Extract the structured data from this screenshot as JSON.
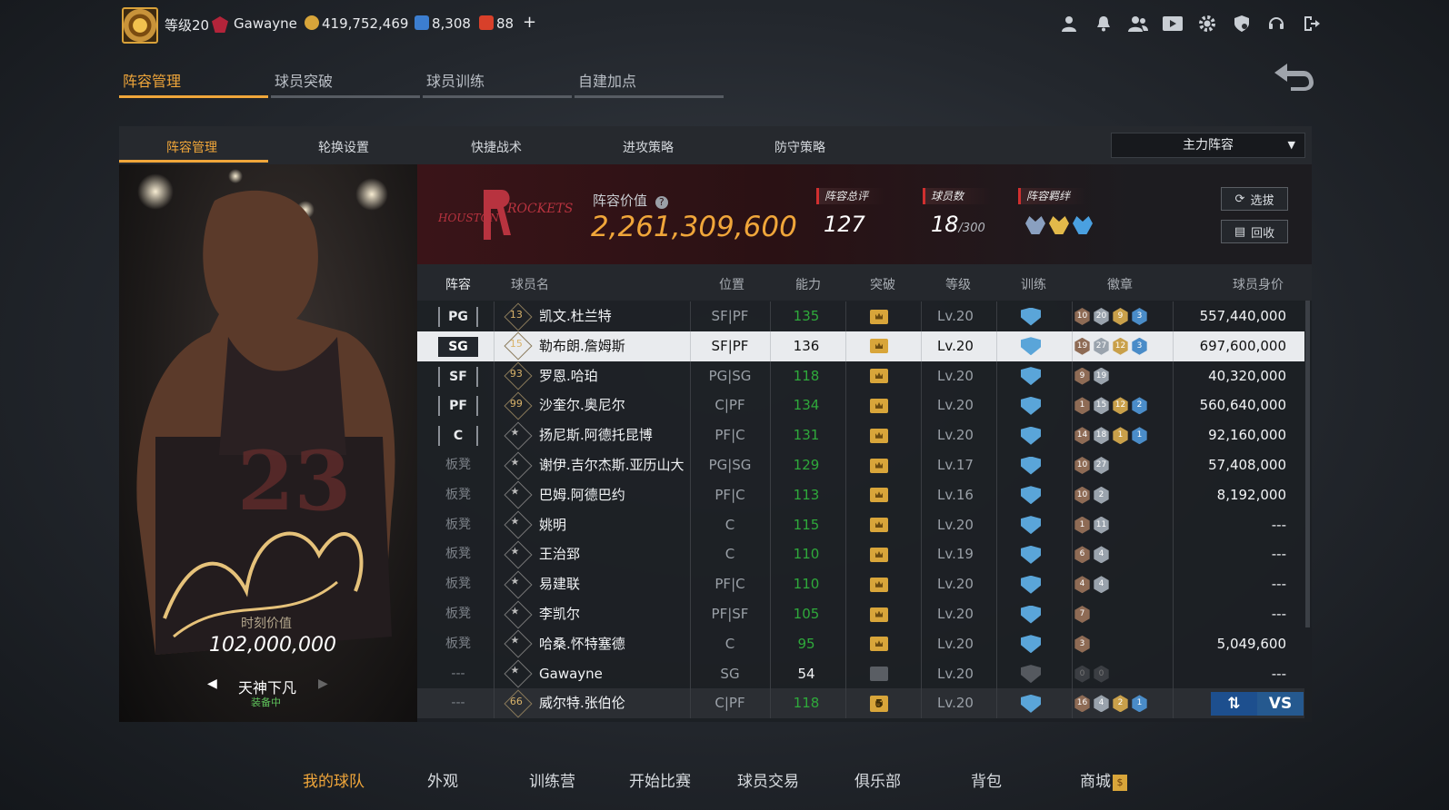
{
  "topbar": {
    "level_label": "等级20",
    "username": "Gawayne",
    "coins": "419,752,469",
    "stars": "8,308",
    "tickets": "88",
    "add": "+"
  },
  "main_tabs": [
    "阵容管理",
    "球员突破",
    "球员训练",
    "自建加点"
  ],
  "sub_tabs": [
    "阵容管理",
    "轮换设置",
    "快捷战术",
    "进攻策略",
    "防守策略"
  ],
  "lineup_select": "主力阵容",
  "card": {
    "value_label": "时刻价值",
    "value": "102,000,000",
    "name": "天神下凡",
    "status": "装备中"
  },
  "team": {
    "value_label": "阵容价值",
    "value": "2,261,309,600",
    "rating_label": "阵容总评",
    "rating": "127",
    "players_label": "球员数",
    "players": "18",
    "players_max": "/300",
    "bond_label": "阵容羁绊",
    "select_btn": "选拔",
    "recycle_btn": "回收"
  },
  "table": {
    "headers": [
      "阵容",
      "球员名",
      "位置",
      "能力",
      "突破",
      "等级",
      "训练",
      "徽章",
      "球员身价"
    ],
    "rows": [
      {
        "slot": "PG",
        "num": "13",
        "name": "凯文.杜兰特",
        "pos": "SF|PF",
        "ability": "135",
        "level": "Lv.20",
        "badges": [
          "10",
          "20",
          "9",
          "3"
        ],
        "worth": "557,440,000"
      },
      {
        "slot": "SG",
        "num": "15",
        "name": "勒布朗.詹姆斯",
        "pos": "SF|PF",
        "ability": "136",
        "level": "Lv.20",
        "badges": [
          "19",
          "27",
          "12",
          "3"
        ],
        "worth": "697,600,000"
      },
      {
        "slot": "SF",
        "num": "93",
        "name": "罗恩.哈珀",
        "pos": "PG|SG",
        "ability": "118",
        "level": "Lv.20",
        "badges": [
          "9",
          "19"
        ],
        "worth": "40,320,000"
      },
      {
        "slot": "PF",
        "num": "99",
        "name": "沙奎尔.奥尼尔",
        "pos": "C|PF",
        "ability": "134",
        "level": "Lv.20",
        "badges": [
          "1",
          "15",
          "12",
          "2"
        ],
        "worth": "560,640,000"
      },
      {
        "slot": "C",
        "num": "",
        "name": "扬尼斯.阿德托昆博",
        "pos": "PF|C",
        "ability": "131",
        "level": "Lv.20",
        "badges": [
          "14",
          "18",
          "1",
          "1"
        ],
        "worth": "92,160,000"
      },
      {
        "slot": "板凳",
        "num": "",
        "name": "谢伊.吉尔杰斯.亚历山大",
        "pos": "PG|SG",
        "ability": "129",
        "level": "Lv.17",
        "badges": [
          "10",
          "27"
        ],
        "worth": "57,408,000"
      },
      {
        "slot": "板凳",
        "num": "",
        "name": "巴姆.阿德巴约",
        "pos": "PF|C",
        "ability": "113",
        "level": "Lv.16",
        "badges": [
          "10",
          "2"
        ],
        "worth": "8,192,000"
      },
      {
        "slot": "板凳",
        "num": "",
        "name": "姚明",
        "pos": "C",
        "ability": "115",
        "level": "Lv.20",
        "badges": [
          "1",
          "11"
        ],
        "worth": "---"
      },
      {
        "slot": "板凳",
        "num": "",
        "name": "王治郅",
        "pos": "C",
        "ability": "110",
        "level": "Lv.19",
        "badges": [
          "6",
          "4"
        ],
        "worth": "---"
      },
      {
        "slot": "板凳",
        "num": "",
        "name": "易建联",
        "pos": "PF|C",
        "ability": "110",
        "level": "Lv.20",
        "badges": [
          "4",
          "4"
        ],
        "worth": "---"
      },
      {
        "slot": "板凳",
        "num": "",
        "name": "李凯尔",
        "pos": "PF|SF",
        "ability": "105",
        "level": "Lv.20",
        "badges": [
          "7"
        ],
        "worth": "---"
      },
      {
        "slot": "板凳",
        "num": "",
        "name": "哈桑.怀特塞德",
        "pos": "C",
        "ability": "95",
        "level": "Lv.20",
        "badges": [
          "3"
        ],
        "worth": "5,049,600"
      },
      {
        "slot": "---",
        "num": "",
        "name": "Gawayne",
        "pos": "SG",
        "ability": "54",
        "level": "Lv.20",
        "badges": [
          "0",
          "0"
        ],
        "worth": "---"
      },
      {
        "slot": "---",
        "num": "66",
        "name": "威尔特.张伯伦",
        "pos": "C|PF",
        "ability": "118",
        "level": "Lv.20",
        "badges": [
          "16",
          "4",
          "2",
          "1"
        ],
        "worth": ""
      }
    ],
    "breakthrough_last": "5",
    "vs_label": "VS"
  },
  "bottom_nav": [
    "我的球队",
    "外观",
    "训练营",
    "开始比赛",
    "球员交易",
    "俱乐部",
    "背包",
    "商城"
  ],
  "colors": {
    "accent": "#f0a63a",
    "green": "#2fa93b",
    "blue": "#1d4f8e"
  }
}
